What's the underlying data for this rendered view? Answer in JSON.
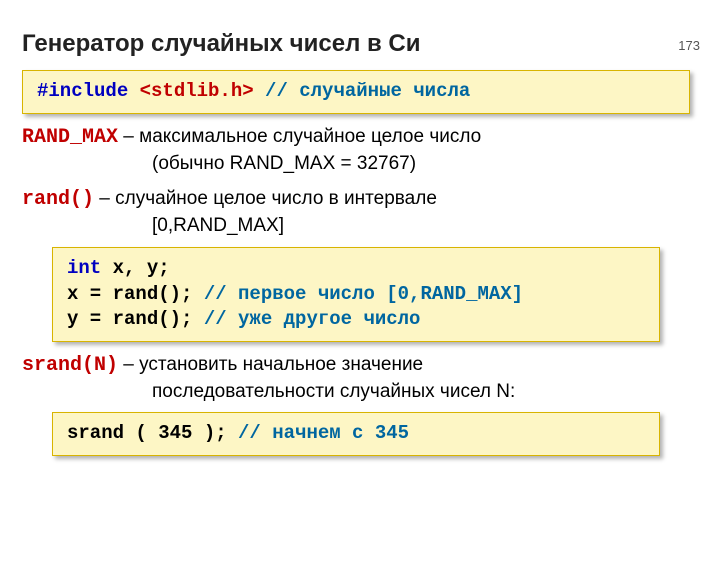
{
  "page_number": "173",
  "title": "Генератор случайных чисел в Си",
  "code1": {
    "include": "#include",
    "lib": " <stdlib.h>",
    "spacer": "   ",
    "comment": "// случайные числа"
  },
  "p1": {
    "term": "RAND_MAX",
    "rest": " – максимальное случайное целое число",
    "line2": "(обычно RAND_MAX = 32767)"
  },
  "p2": {
    "term": "rand()",
    "rest": "  – случайное целое число в интервале",
    "line2": "[0,RAND_MAX]"
  },
  "code2": {
    "decl_kw": "int",
    "decl_rest": " x, y;",
    "l2a": "x = rand(); ",
    "l2c": "// первое число [0,RAND_MAX]",
    "l3a": "y = rand(); ",
    "l3c": "// уже другое число"
  },
  "p3": {
    "term": "srand(N)",
    "rest": " – установить начальное значение",
    "line2": "последовательности случайных чисел N:"
  },
  "code3": {
    "call": "srand ( 345 ); ",
    "comment": "// начнем с 345"
  }
}
